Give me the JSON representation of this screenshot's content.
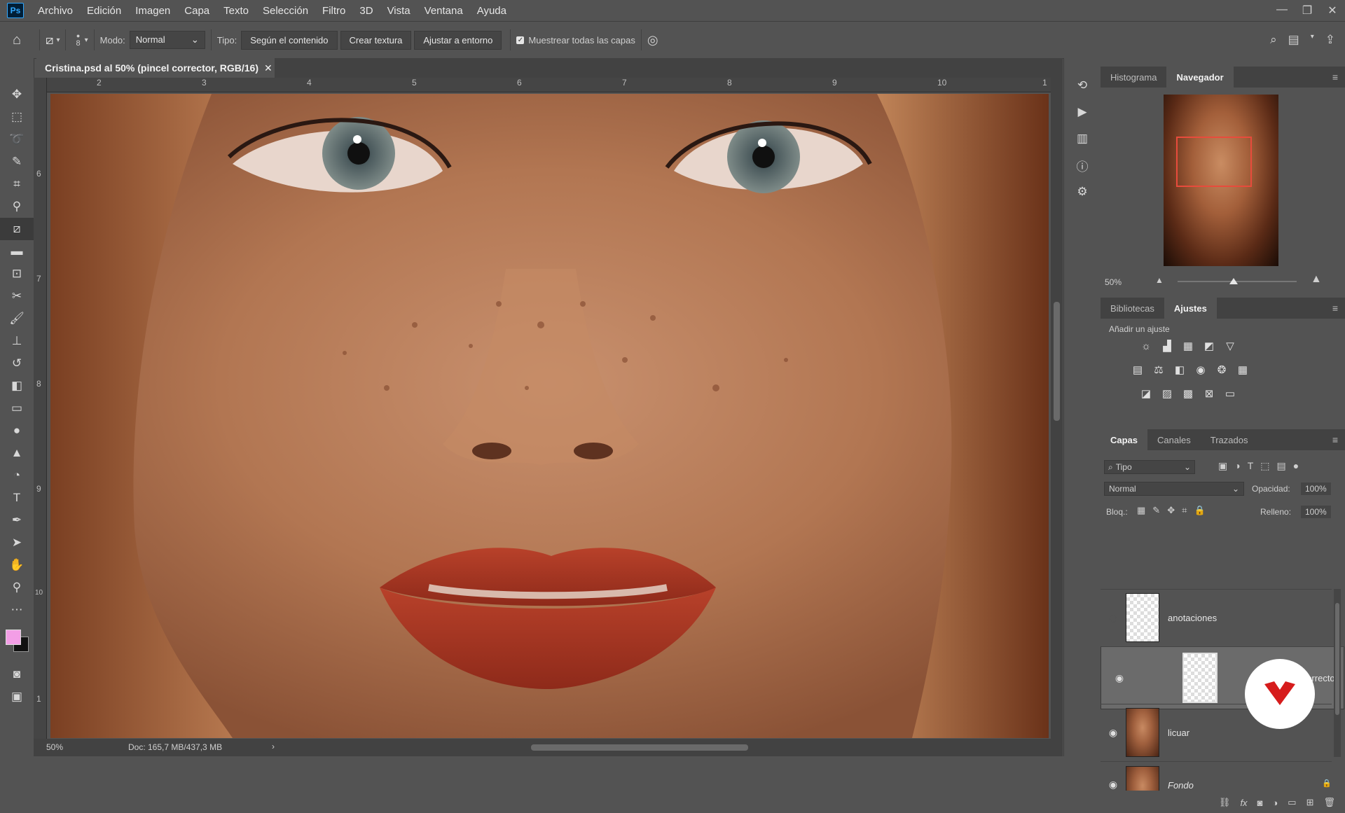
{
  "app": {
    "logo": "Ps"
  },
  "menu": [
    "Archivo",
    "Edición",
    "Imagen",
    "Capa",
    "Texto",
    "Selección",
    "Filtro",
    "3D",
    "Vista",
    "Ventana",
    "Ayuda"
  ],
  "window_controls": [
    "—",
    "❐",
    "✕"
  ],
  "options": {
    "brush_size": "8",
    "mode_label": "Modo:",
    "mode_value": "Normal",
    "type_label": "Tipo:",
    "type_buttons": [
      "Según el contenido",
      "Crear textura",
      "Ajustar a entorno"
    ],
    "sample_all_layers": "Muestrear todas las capas",
    "sample_checked": true
  },
  "document": {
    "tab_title": "Cristina.psd al 50% (pincel corrector, RGB/16)",
    "ruler_top_labels": [
      "2",
      "3",
      "4",
      "5",
      "6",
      "7",
      "8",
      "9",
      "10",
      "1"
    ],
    "ruler_left_labels": [
      "6",
      "7",
      "8",
      "9",
      "10",
      "1"
    ],
    "zoom": "50%",
    "doc_info": "Doc: 165,7 MB/437,3 MB"
  },
  "navigator": {
    "tabs": [
      "Histograma",
      "Navegador"
    ],
    "active_tab": "Navegador",
    "zoom": "50%"
  },
  "adjustments": {
    "tabs": [
      "Bibliotecas",
      "Ajustes"
    ],
    "active_tab": "Ajustes",
    "add_label": "Añadir un ajuste"
  },
  "layers_panel": {
    "tabs": [
      "Capas",
      "Canales",
      "Trazados"
    ],
    "active_tab": "Capas",
    "filter_kind": "Tipo",
    "blend_mode": "Normal",
    "opacity_label": "Opacidad:",
    "opacity_value": "100%",
    "lock_label": "Bloq.:",
    "fill_label": "Relleno:",
    "fill_value": "100%",
    "layers": [
      {
        "name": "anotaciones",
        "visible": false,
        "selected": false
      },
      {
        "name": "pincel corrector",
        "visible": true,
        "selected": true
      },
      {
        "name": "licuar",
        "visible": true,
        "selected": false
      },
      {
        "name": "Fondo",
        "visible": true,
        "selected": false
      }
    ]
  },
  "colors": {
    "foreground": "#f39ee6",
    "background": "#111111",
    "ui_bg": "#535353",
    "panel_dark": "#424242"
  }
}
